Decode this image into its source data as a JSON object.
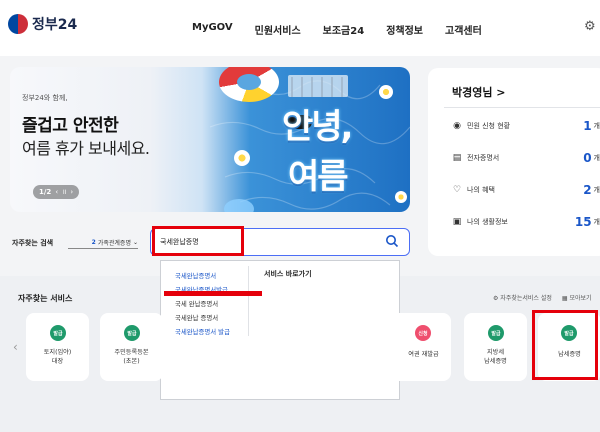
{
  "header": {
    "logo_text": "정부24",
    "nav": [
      "MyGOV",
      "민원서비스",
      "보조금24",
      "정책정보",
      "고객센터"
    ],
    "icon": "settings-icon"
  },
  "banner": {
    "small_text": "정부24와 함께,",
    "title": "즐겁고 안전한",
    "subtitle": "여름 휴가 보내세요.",
    "pager": "1/2",
    "art_line1": "안녕,",
    "art_line2": "여름"
  },
  "profile": {
    "name": "박경영님 >",
    "rows": [
      {
        "icon": "person-circle-icon",
        "label": "민원 신청 현황",
        "value": "1",
        "unit": "개"
      },
      {
        "icon": "document-icon",
        "label": "전자증명서",
        "value": "0",
        "unit": "개"
      },
      {
        "icon": "heart-icon",
        "label": "나의 혜택",
        "value": "2",
        "unit": "개"
      },
      {
        "icon": "info-card-icon",
        "label": "나의 생활정보",
        "value": "15",
        "unit": "개"
      }
    ]
  },
  "search": {
    "label": "자주찾는 검색",
    "select_num": "2",
    "select_text": "가족관계증명",
    "value": "국세완납증명"
  },
  "dropdown": {
    "items": [
      "국세완납증명서",
      "국세완납증명서발급",
      "국세 완납증명서",
      "국세완납 증명서",
      "국세완납증명서 발급"
    ],
    "right_heading": "서비스 바로가기"
  },
  "services": {
    "title": "자주찾는 서비스",
    "settings_label": "자주찾는서비스 설정",
    "more_label": "모아보기",
    "cards": [
      {
        "badge": "발급",
        "badge_color": "#1f9a6b",
        "label": "토지(임야)\n대장"
      },
      {
        "badge": "발급",
        "badge_color": "#1f9a6b",
        "label": "주민등록등본\n(초본)"
      },
      {
        "badge": "신청",
        "badge_color": "#ef4f6e",
        "label": "여권 재발급"
      },
      {
        "badge": "발급",
        "badge_color": "#1f9a6b",
        "label": "지방세\n납세증명"
      },
      {
        "badge": "발급",
        "badge_color": "#1f9a6b",
        "label": "납세증명"
      }
    ]
  }
}
